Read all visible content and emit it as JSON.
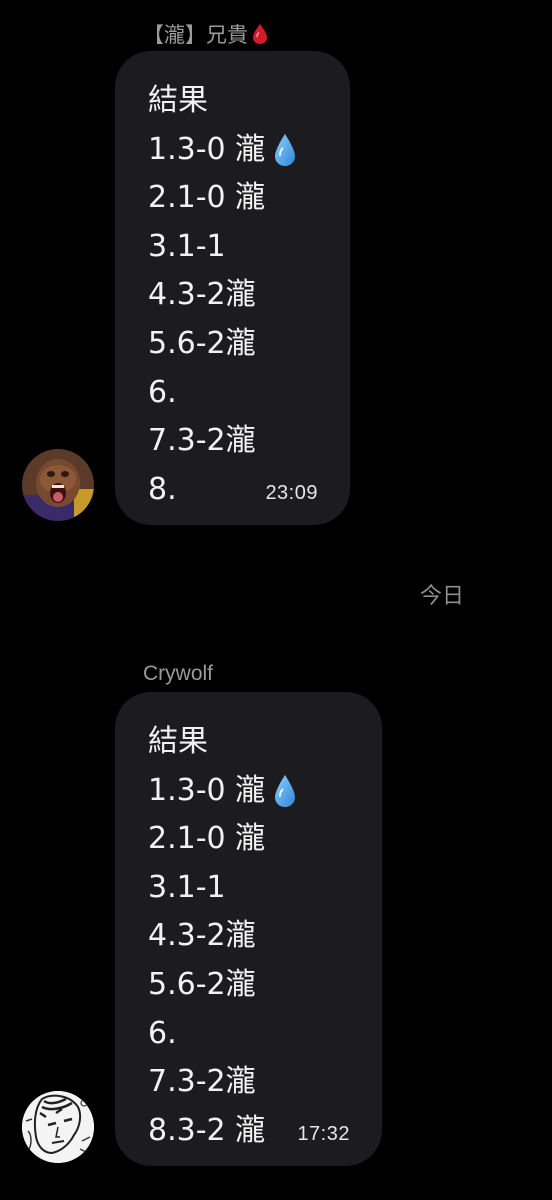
{
  "chat": {
    "date_divider": "今日",
    "messages": [
      {
        "sender": "【瀧】兄貴",
        "sender_emoji_icon": "drop-of-blood-icon",
        "lines": [
          "結果",
          "1.3-0 瀧",
          "2.1-0 瀧",
          "3.1-1",
          "4.3-2瀧",
          "5.6-2瀧",
          "6.",
          "7.3-2瀧",
          "8."
        ],
        "line_2_emoji_icon": "droplet-icon",
        "time": "23:09",
        "avatar_icon": "screaming-child-avatar-icon"
      },
      {
        "sender": "Crywolf",
        "lines": [
          "結果",
          "1.3-0 瀧",
          "2.1-0 瀧",
          "3.1-1",
          "4.3-2瀧",
          "5.6-2瀧",
          "6.",
          "7.3-2瀧",
          "8.3-2 瀧"
        ],
        "line_2_emoji_icon": "droplet-icon",
        "time": "17:32",
        "avatar_icon": "manga-sketch-avatar-icon"
      }
    ]
  },
  "colors": {
    "background": "#000000",
    "bubble": "#1c1c1e",
    "sender_text": "#9a9a9a",
    "droplet": "#4ea6e8",
    "blood": "#d21c2a"
  }
}
